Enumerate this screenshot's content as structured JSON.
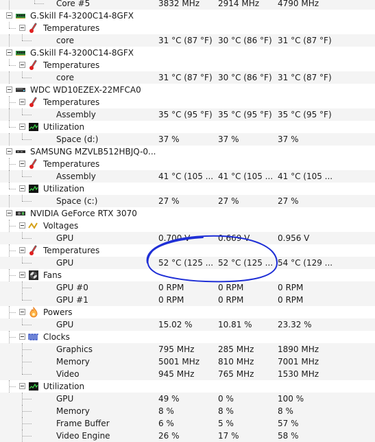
{
  "rows": [
    {
      "kind": "data",
      "level": 3,
      "label": "Core #5",
      "values": [
        "3832 MHz",
        "2914 MHz",
        "4790 MHz"
      ],
      "last": true
    },
    {
      "kind": "device",
      "level": 0,
      "label": "G.Skill F4-3200C14-8GFX",
      "icon": "ram-icon"
    },
    {
      "kind": "group",
      "level": 1,
      "label": "Temperatures",
      "icon": "thermometer-icon",
      "last": true
    },
    {
      "kind": "data",
      "level": 2,
      "label": "core",
      "values": [
        "31 °C  (87 °F)",
        "30 °C  (86 °F)",
        "31 °C  (87 °F)"
      ],
      "last": true
    },
    {
      "kind": "device",
      "level": 0,
      "label": "G.Skill F4-3200C14-8GFX",
      "icon": "ram-icon"
    },
    {
      "kind": "group",
      "level": 1,
      "label": "Temperatures",
      "icon": "thermometer-icon",
      "last": true
    },
    {
      "kind": "data",
      "level": 2,
      "label": "core",
      "values": [
        "31 °C  (87 °F)",
        "30 °C  (86 °F)",
        "31 °C  (87 °F)"
      ],
      "last": true
    },
    {
      "kind": "device",
      "level": 0,
      "label": "WDC WD10EZEX-22MFCA0",
      "icon": "hdd-icon"
    },
    {
      "kind": "group",
      "level": 1,
      "label": "Temperatures",
      "icon": "thermometer-icon"
    },
    {
      "kind": "data",
      "level": 2,
      "label": "Assembly",
      "values": [
        "35 °C  (95 °F)",
        "35 °C  (95 °F)",
        "35 °C  (95 °F)"
      ],
      "last": true
    },
    {
      "kind": "group",
      "level": 1,
      "label": "Utilization",
      "icon": "utilization-icon",
      "last": true
    },
    {
      "kind": "data",
      "level": 2,
      "label": "Space (d:)",
      "values": [
        "37 %",
        "37 %",
        "37 %"
      ],
      "last": true
    },
    {
      "kind": "device",
      "level": 0,
      "label": "SAMSUNG MZVLB512HBJQ-0...",
      "icon": "ssd-icon"
    },
    {
      "kind": "group",
      "level": 1,
      "label": "Temperatures",
      "icon": "thermometer-icon"
    },
    {
      "kind": "data",
      "level": 2,
      "label": "Assembly",
      "values": [
        "41 °C  (105 ...",
        "41 °C  (105 ...",
        "41 °C  (105 ..."
      ],
      "last": true
    },
    {
      "kind": "group",
      "level": 1,
      "label": "Utilization",
      "icon": "utilization-icon",
      "last": true
    },
    {
      "kind": "data",
      "level": 2,
      "label": "Space (c:)",
      "values": [
        "27 %",
        "27 %",
        "27 %"
      ],
      "last": true
    },
    {
      "kind": "device",
      "level": 0,
      "label": "NVIDIA GeForce RTX 3070",
      "icon": "gpu-icon"
    },
    {
      "kind": "group",
      "level": 1,
      "label": "Voltages",
      "icon": "voltage-icon"
    },
    {
      "kind": "data",
      "level": 2,
      "label": "GPU",
      "values": [
        "0.700 V",
        "0.669 V",
        "0.956 V"
      ],
      "last": true
    },
    {
      "kind": "group",
      "level": 1,
      "label": "Temperatures",
      "icon": "thermometer-icon"
    },
    {
      "kind": "data",
      "level": 2,
      "label": "GPU",
      "values": [
        "52 °C  (125 ...",
        "52 °C  (125 ...",
        "54 °C  (129 ..."
      ],
      "last": true
    },
    {
      "kind": "group",
      "level": 1,
      "label": "Fans",
      "icon": "fan-icon"
    },
    {
      "kind": "data",
      "level": 2,
      "label": "GPU #0",
      "values": [
        "0 RPM",
        "0 RPM",
        "0 RPM"
      ]
    },
    {
      "kind": "data",
      "level": 2,
      "label": "GPU #1",
      "values": [
        "0 RPM",
        "0 RPM",
        "0 RPM"
      ],
      "last": true
    },
    {
      "kind": "group",
      "level": 1,
      "label": "Powers",
      "icon": "power-icon"
    },
    {
      "kind": "data",
      "level": 2,
      "label": "GPU",
      "values": [
        "15.02 %",
        "10.81 %",
        "23.32 %"
      ],
      "last": true
    },
    {
      "kind": "group",
      "level": 1,
      "label": "Clocks",
      "icon": "clock-icon"
    },
    {
      "kind": "data",
      "level": 2,
      "label": "Graphics",
      "values": [
        "795 MHz",
        "285 MHz",
        "1890 MHz"
      ]
    },
    {
      "kind": "data",
      "level": 2,
      "label": "Memory",
      "values": [
        "5001 MHz",
        "810 MHz",
        "7001 MHz"
      ]
    },
    {
      "kind": "data",
      "level": 2,
      "label": "Video",
      "values": [
        "945 MHz",
        "765 MHz",
        "1530 MHz"
      ],
      "last": true
    },
    {
      "kind": "group",
      "level": 1,
      "label": "Utilization",
      "icon": "utilization-icon"
    },
    {
      "kind": "data",
      "level": 2,
      "label": "GPU",
      "values": [
        "49 %",
        "0 %",
        "100 %"
      ]
    },
    {
      "kind": "data",
      "level": 2,
      "label": "Memory",
      "values": [
        "8 %",
        "8 %",
        "8 %"
      ]
    },
    {
      "kind": "data",
      "level": 2,
      "label": "Frame Buffer",
      "values": [
        "6 %",
        "5 %",
        "57 %"
      ]
    },
    {
      "kind": "data",
      "level": 2,
      "label": "Video Engine",
      "values": [
        "26 %",
        "17 %",
        "58 %"
      ]
    }
  ],
  "annotation": {
    "kind": "hand-drawn-circle",
    "color": "#1f2fd6"
  }
}
